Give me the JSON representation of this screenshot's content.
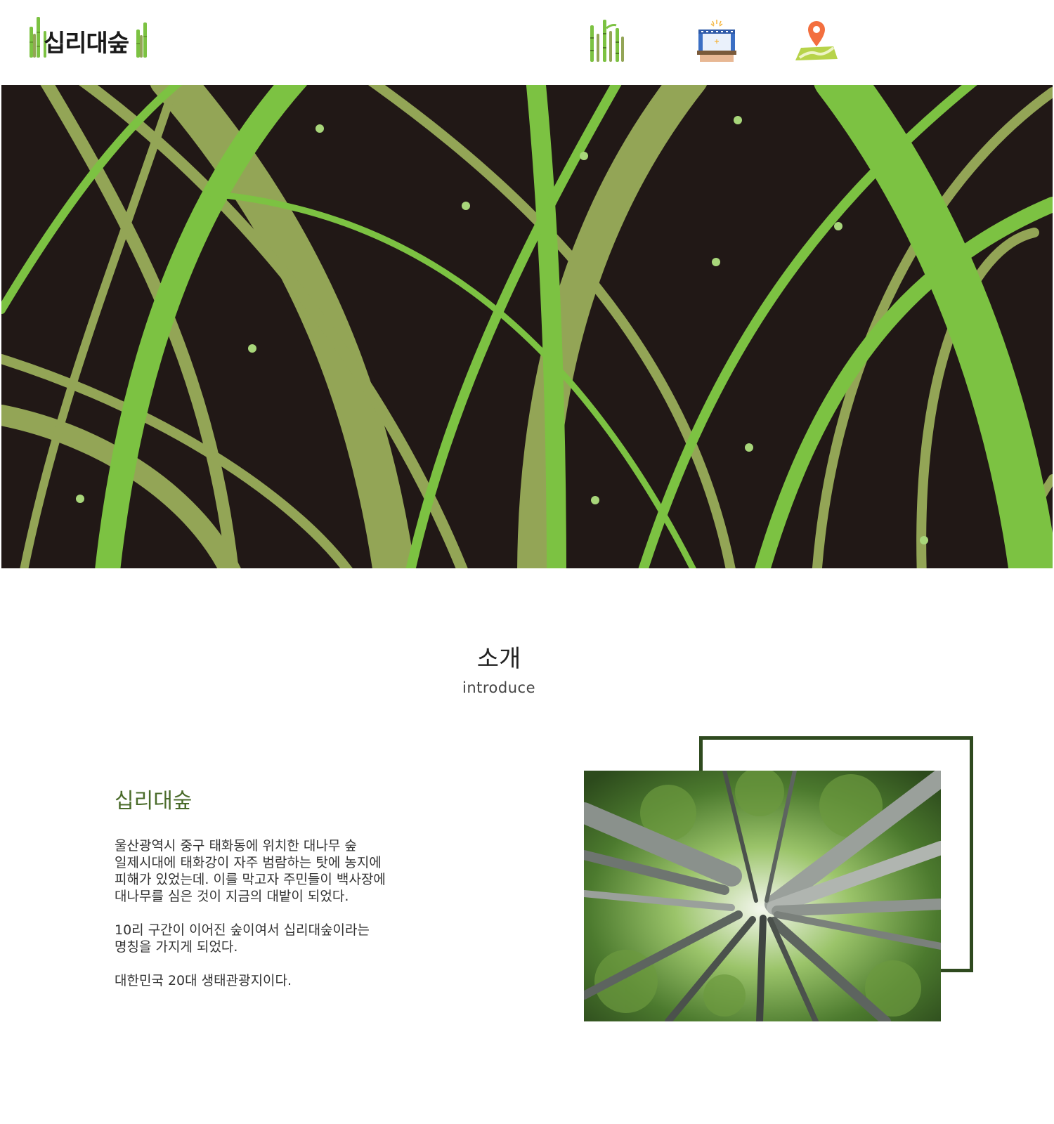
{
  "header": {
    "logo_text": "십리대숲",
    "nav": [
      {
        "name": "bamboo-icon"
      },
      {
        "name": "festival-stage-icon"
      },
      {
        "name": "map-location-icon"
      }
    ]
  },
  "colors": {
    "hero_background": "#211816",
    "bright_green": "#7cc242",
    "olive_green": "#93a556",
    "dot_green": "#a8d67a",
    "heading_green": "#4a6b2a",
    "frame_green": "#2f4a1f",
    "pin_orange": "#f36f3f"
  },
  "intro": {
    "title": "소개",
    "subtitle": "introduce",
    "heading": "십리대숲",
    "paragraphs": [
      "울산광역시 중구 태화동에 위치한 대나무 숲\n일제시대에 태화강이 자주 범람하는 탓에 농지에\n피해가 있었는데. 이를 막고자 주민들이 백사장에\n대나무를 심은 것이 지금의 대밭이 되었다.",
      "10리 구간이 이어진 숲이여서 십리대숲이라는\n명칭을 가지게 되었다.",
      "대한민국 20대 생태관광지이다."
    ]
  }
}
